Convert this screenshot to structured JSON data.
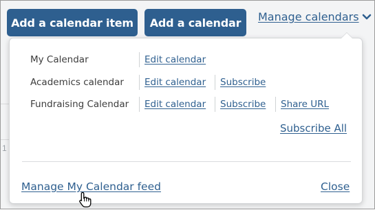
{
  "toolbar": {
    "add_item_label": "Add a calendar item",
    "add_calendar_label": "Add a calendar",
    "manage_label": "Manage calendars"
  },
  "background": {
    "partial_day_number": "1"
  },
  "dropdown": {
    "calendars": [
      {
        "name": "My Calendar",
        "edit": "Edit calendar"
      },
      {
        "name": "Academics calendar",
        "edit": "Edit calendar",
        "subscribe": "Subscribe"
      },
      {
        "name": "Fundraising Calendar",
        "edit": "Edit calendar",
        "subscribe": "Subscribe",
        "share": "Share URL"
      }
    ],
    "subscribe_all": "Subscribe All",
    "manage_feed": "Manage My Calendar feed",
    "close": "Close"
  },
  "colors": {
    "brand": "#2e5f8f",
    "panel_border": "#d4d6d8",
    "label_text": "#3c3c3c"
  },
  "icons": {
    "manage_chevron": "chevron-down-icon",
    "cursor": "hand-pointer-icon"
  }
}
